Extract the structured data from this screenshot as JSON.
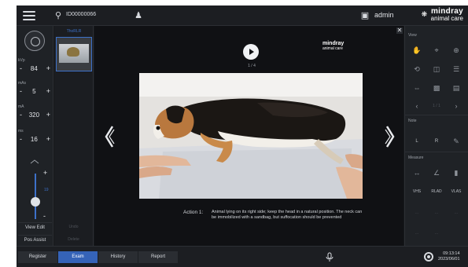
{
  "topbar": {
    "patient_id": "ID00000066",
    "user": "admin",
    "brand_line1": "mindray",
    "brand_line2": "animal care"
  },
  "left_panel": {
    "params": [
      {
        "label": "kVp",
        "value": "84"
      },
      {
        "label": "mAs",
        "value": "5"
      },
      {
        "label": "mA",
        "value": "320"
      },
      {
        "label": "ms",
        "value": "16"
      }
    ],
    "slider_value": "19",
    "view_edit_label": "View Edit",
    "pos_assist_label": "Pos Assist"
  },
  "thumbnails": {
    "label": "ThoRLR",
    "undo_label": "Undo",
    "delete_label": "Delete"
  },
  "viewer": {
    "page_indicator": "1 / 4",
    "brand_line1": "mindray",
    "brand_line2": "animal care",
    "action_label": "Action 1:",
    "action_text": "Animal lying on its right side; keep the head in a natural position. The neck can be immobilized with a sandbag, but suffocation should be prevented"
  },
  "right_panel": {
    "view_label": "View",
    "note_label": "Note",
    "measure_label": "Measure",
    "note_left": "L",
    "note_right": "R",
    "vhs": "VHS",
    "rlad": "RLAD",
    "vlas": "VLAS",
    "page": "1 / 1"
  },
  "bottom": {
    "tabs": [
      "Register",
      "Exam",
      "History",
      "Report"
    ],
    "active_tab": "Exam",
    "time": "09:13:14",
    "date": "2023/06/01"
  },
  "colors": {
    "accent": "#3563b8",
    "background": "#17191c"
  }
}
